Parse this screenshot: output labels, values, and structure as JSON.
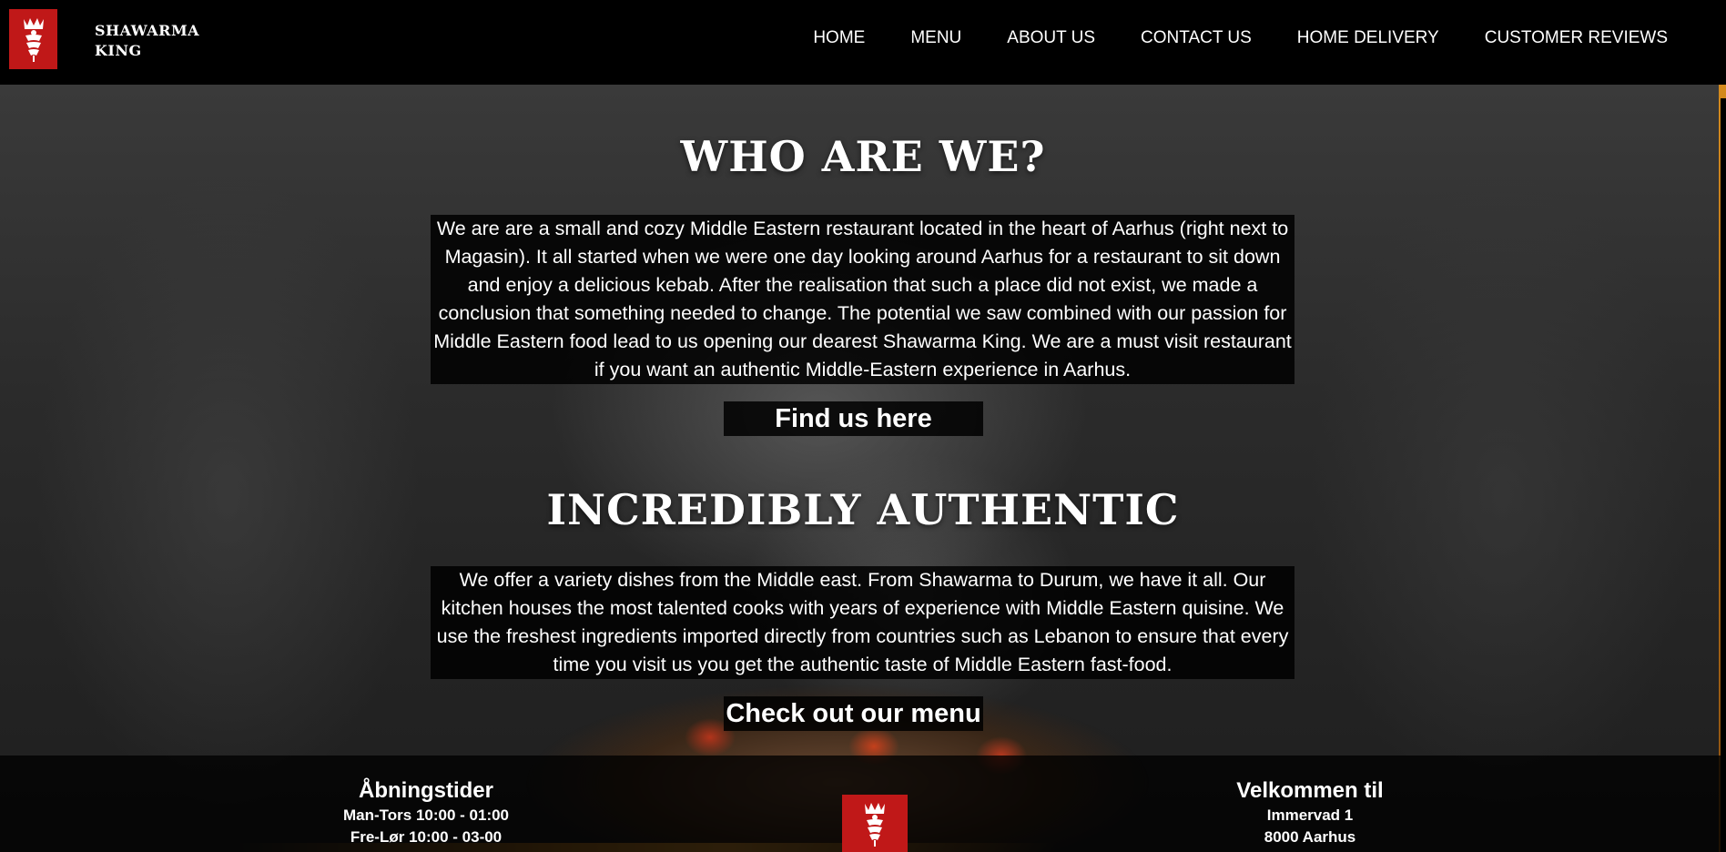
{
  "brand": {
    "line1": "SHAWARMA",
    "line2": "KING",
    "logo_icon": "crown-shawarma-logo-icon",
    "logo_color": "#c01818"
  },
  "nav": {
    "items": [
      {
        "label": "HOME"
      },
      {
        "label": "MENU"
      },
      {
        "label": "ABOUT US"
      },
      {
        "label": "CONTACT US"
      },
      {
        "label": "HOME DELIVERY"
      },
      {
        "label": "CUSTOMER REVIEWS"
      }
    ]
  },
  "about": {
    "title": "WHO ARE WE?",
    "text": "We are are a small and cozy Middle Eastern restaurant located in the heart of Aarhus (right next to Magasin). It all started when we were one day looking around Aarhus for a restaurant to sit down and enjoy a delicious kebab. After the realisation that such a place did not exist, we made a conclusion that something needed to change. The potential we saw combined with our passion for Middle Eastern food lead to us opening our dearest Shawarma King. We are a must visit restaurant if you want an authentic Middle-Eastern experience in Aarhus.",
    "button": "Find us here"
  },
  "authentic": {
    "title": "INCREDIBLY AUTHENTIC",
    "text": "We offer a variety dishes from the Middle east. From Shawarma to Durum, we have it all. Our kitchen houses the most talented cooks with years of experience with Middle Eastern quisine. We use the freshest ingredients imported directly from countries such as Lebanon to ensure that every time you visit us you get the authentic taste of Middle Eastern fast-food.",
    "button": "Check out our menu"
  },
  "footer": {
    "hours": {
      "title": "Åbningstider",
      "line1": "Man-Tors 10:00 - 01:00",
      "line2": "Fre-Lør 10:00 - 03-00"
    },
    "address": {
      "title": "Velkommen til",
      "line1": "Immervad 1",
      "line2": "8000 Aarhus"
    }
  }
}
